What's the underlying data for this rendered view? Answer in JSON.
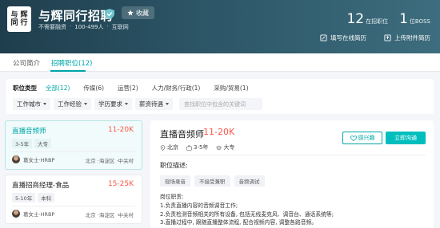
{
  "header": {
    "logo_text": [
      "与",
      "辉",
      "同",
      "行"
    ],
    "company_name": "与辉同行招聘",
    "collect_label": "收藏",
    "meta": [
      "不需要融资",
      "·",
      "100-499人",
      "·",
      "互联网"
    ],
    "stats": [
      {
        "value": "12",
        "label": "在招职位"
      },
      {
        "value": "1",
        "label": "位BOSS"
      }
    ],
    "actions": [
      {
        "icon": "edit-icon",
        "label": "填写在线简历"
      },
      {
        "icon": "upload-icon",
        "label": "上传附件简历"
      }
    ]
  },
  "tabs": [
    {
      "label": "公司简介",
      "active": false
    },
    {
      "label": "招聘职位(12)",
      "active": true
    }
  ],
  "filter": {
    "title": "职位类型",
    "options": [
      "全部(12)",
      "传媒(6)",
      "运营(2)",
      "人力/财务/行政(1)",
      "采购/贸易(1)"
    ],
    "dropdowns": [
      "工作城市",
      "工作经验",
      "学历要求",
      "薪资待遇"
    ],
    "search_placeholder": "查找职位中包含的关键词"
  },
  "jobs": [
    {
      "title": "直播音频师",
      "salary": "11-20K",
      "tags": [
        "3-5年",
        "大专"
      ],
      "recruiter": "葛女士·HRBP",
      "location": "北京 ·海淀区 ·中关村",
      "active": true
    },
    {
      "title": "直播招商经理-食品",
      "salary": "15-25K",
      "tags": [
        "5-10年",
        "本科"
      ],
      "recruiter": "葛女士·HRBP",
      "location": "北京 ·海淀区 ·中关村",
      "active": false
    }
  ],
  "detail": {
    "title": "直播音频师",
    "salary": "11-20K",
    "meta": [
      {
        "icon": "location-icon",
        "text": "北京"
      },
      {
        "icon": "briefcase-icon",
        "text": "3-5年"
      },
      {
        "icon": "education-icon",
        "text": "大专"
      }
    ],
    "interest_label": "感兴趣",
    "chat_label": "立即沟通",
    "section_title": "职位描述:",
    "keywords": [
      "现场录音",
      "不接受兼职",
      "音频调试"
    ],
    "body_lines": [
      "岗位职责:",
      "1.负责直播内容的音频调音工作;",
      "2.负责检测音频相关的所有设备, 包括无线麦克风、调音台、通话系统等;",
      "3.直播过程中, 跟随直播整体流程, 配合视频内容, 调整各路音频。"
    ]
  },
  "colors": {
    "accent": "#00a6a7",
    "salary": "#fe574a",
    "header_bg": "#2c5566"
  }
}
